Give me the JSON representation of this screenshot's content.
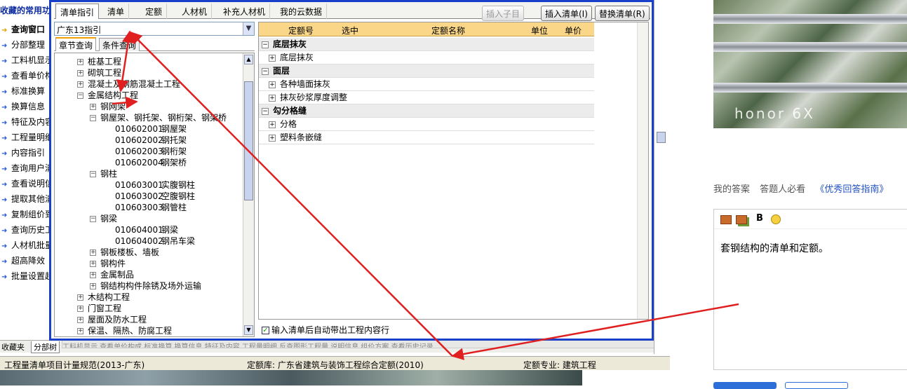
{
  "favorites": {
    "header": "收藏的常用功",
    "items": [
      "查询窗口",
      "分部整理",
      "工料机显示",
      "查看单价构",
      "标准换算",
      "换算信息",
      "特征及内容",
      "工程量明细",
      "内容指引",
      "查询用户清",
      "查看说明信",
      "提取其他清",
      "复制组价到",
      "查询历史工",
      "人材机批量",
      "超高降效",
      "批量设置超"
    ]
  },
  "bottom_tabs": [
    "收藏夹",
    "分部树"
  ],
  "bottom_strip": "工料机显示    查看单价构成    标准换算    换算信息    特征及内容    工程量明细    反查图形工程量    说明信息    组价方案    查看历史记录",
  "status": {
    "spec": "工程量清单项目计量规范(2013-广东)",
    "quota_lib": "定额库: 广东省建筑与装饰工程综合定额(2010)",
    "major": "定额专业: 建筑工程"
  },
  "dialog": {
    "tabs": [
      "清单指引",
      "清单",
      "定额",
      "人材机",
      "补充人材机",
      "我的云数据"
    ],
    "buttons": {
      "insert_child": "插入子目",
      "insert_list": "插入清单(I)",
      "replace_list": "替换清单(R)"
    },
    "combo_value": "广东13指引",
    "subtabs": [
      "章节查询",
      "条件查询"
    ],
    "tree": [
      {
        "label": "桩基工程",
        "level": 0,
        "ex": "+"
      },
      {
        "label": "砌筑工程",
        "level": 0,
        "ex": "+"
      },
      {
        "label": "混凝土及钢筋混凝土工程",
        "level": 0,
        "ex": "+"
      },
      {
        "label": "金属结构工程",
        "level": 0,
        "ex": "−"
      },
      {
        "label": "钢网架",
        "level": 1,
        "ex": "+"
      },
      {
        "label": "钢屋架、钢托架、钢桁架、钢架桥",
        "level": 1,
        "ex": "−"
      },
      {
        "code": "010602001",
        "label": "钢屋架",
        "level": 2
      },
      {
        "code": "010602002",
        "label": "钢托架",
        "level": 2
      },
      {
        "code": "010602003",
        "label": "钢桁架",
        "level": 2
      },
      {
        "code": "010602004",
        "label": "钢架桥",
        "level": 2
      },
      {
        "label": "钢柱",
        "level": 1,
        "ex": "−"
      },
      {
        "code": "010603001",
        "label": "实腹钢柱",
        "level": 2
      },
      {
        "code": "010603002",
        "label": "空腹钢柱",
        "level": 2
      },
      {
        "code": "010603003",
        "label": "钢管柱",
        "level": 2
      },
      {
        "label": "钢梁",
        "level": 1,
        "ex": "−"
      },
      {
        "code": "010604001",
        "label": "钢梁",
        "level": 2
      },
      {
        "code": "010604002",
        "label": "钢吊车梁",
        "level": 2
      },
      {
        "label": "钢板楼板、墙板",
        "level": 1,
        "ex": "+"
      },
      {
        "label": "钢构件",
        "level": 1,
        "ex": "+"
      },
      {
        "label": "金属制品",
        "level": 1,
        "ex": "+"
      },
      {
        "label": "钢结构构件除锈及场外运输",
        "level": 1,
        "ex": "+"
      },
      {
        "label": "木结构工程",
        "level": 0,
        "ex": "+"
      },
      {
        "label": "门窗工程",
        "level": 0,
        "ex": "+"
      },
      {
        "label": "屋面及防水工程",
        "level": 0,
        "ex": "+"
      },
      {
        "label": "保温、隔热、防腐工程",
        "level": 0,
        "ex": "+"
      }
    ],
    "grid_headers": [
      "定额号",
      "选中",
      "定额名称",
      "单位",
      "单价"
    ],
    "grid_rows": [
      {
        "type": "grp",
        "ex": "−",
        "label": "底层抹灰"
      },
      {
        "type": "sub",
        "ex": "+",
        "label": "底层抹灰"
      },
      {
        "type": "grp",
        "ex": "−",
        "label": "面层"
      },
      {
        "type": "sub",
        "ex": "+",
        "label": "各种墙面抹灰"
      },
      {
        "type": "sub",
        "ex": "+",
        "label": "抹灰砂浆厚度调整"
      },
      {
        "type": "grp",
        "ex": "−",
        "label": "勾分格缝"
      },
      {
        "type": "sub",
        "ex": "+",
        "label": "分格"
      },
      {
        "type": "sub",
        "ex": "+",
        "label": "塑料条嵌缝"
      }
    ],
    "auto_check_label": "输入清单后自动带出工程内容行"
  },
  "answer_page": {
    "photo_watermark": "honor 6X",
    "links": [
      "我的答案",
      "答题人必看"
    ],
    "guide_link": "《优秀回答指南》",
    "editor_text": "套钢结构的清单和定额。",
    "editor_tools": [
      "image-icon",
      "image-gallery-icon",
      "bold-icon",
      "emoji-icon"
    ],
    "bold_label": "B"
  },
  "colors": {
    "dialog_border": "#1a3fc8",
    "grid_header": "#fad689",
    "annotation_arrow": "#e02020"
  }
}
